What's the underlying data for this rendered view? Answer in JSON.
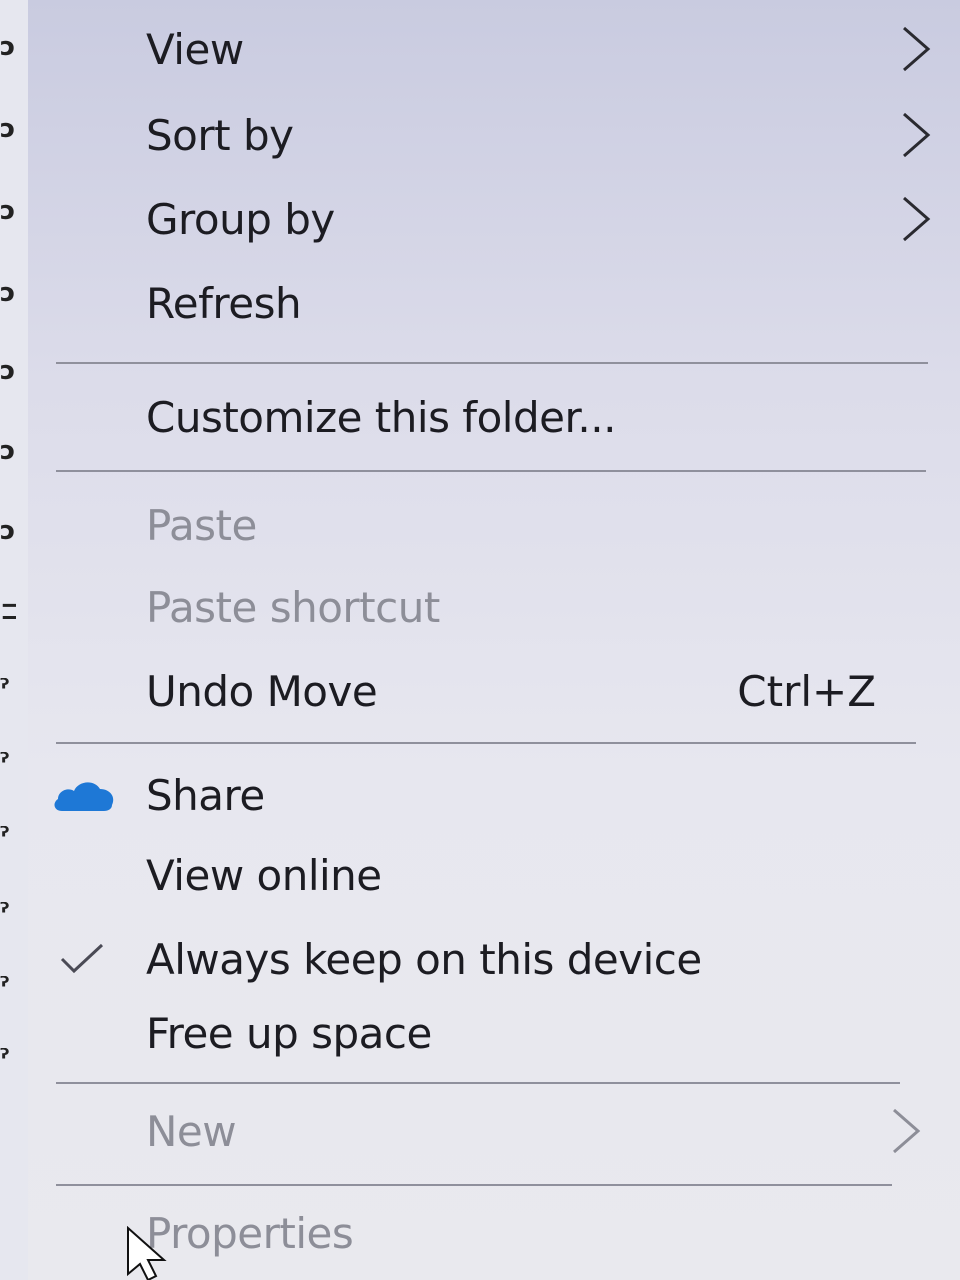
{
  "menu": {
    "view": "View",
    "sort_by": "Sort by",
    "group_by": "Group by",
    "refresh": "Refresh",
    "customize": "Customize this folder...",
    "paste": "Paste",
    "paste_shortcut": "Paste shortcut",
    "undo_move": "Undo Move",
    "undo_shortcut": "Ctrl+Z",
    "share": "Share",
    "view_online": "View online",
    "always_keep": "Always keep on this device",
    "free_up": "Free up space",
    "new": "New",
    "properties": "Properties"
  },
  "states": {
    "paste_enabled": false,
    "paste_shortcut_enabled": false,
    "always_keep_checked": true
  },
  "icons": {
    "submenu": "chevron-right-icon",
    "share": "onedrive-cloud-icon",
    "checked": "checkmark-icon"
  },
  "colors": {
    "cloud": "#1e78d6",
    "disabled_text": "#8d8e98",
    "text": "#1c1c22"
  }
}
